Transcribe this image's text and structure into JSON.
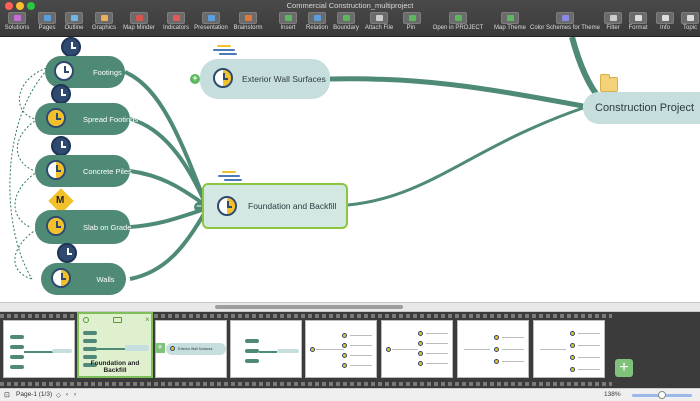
{
  "window": {
    "title": "Commercial Construction_multiproject"
  },
  "toolbar": {
    "items": [
      {
        "label": "Solutions",
        "icon": "solutions-icon",
        "color": "#c96bd8"
      },
      {
        "label": "Pages",
        "icon": "pages-icon",
        "color": "#5b9ee0"
      },
      {
        "label": "Outline",
        "icon": "outline-icon",
        "color": "#6fb6e8"
      },
      {
        "label": "Graphics",
        "icon": "graphics-icon",
        "color": "#e8b05a"
      },
      {
        "label": "Map Minder",
        "icon": "map-minder-icon",
        "color": "#d9534f"
      },
      {
        "label": "Indicators",
        "icon": "indicators-icon",
        "color": "#e05a5a"
      },
      {
        "label": "Presentation",
        "icon": "presentation-icon",
        "color": "#5aa0e0"
      },
      {
        "label": "Brainstorm",
        "icon": "brainstorm-icon",
        "color": "#e07a3a"
      },
      {
        "label": "Insert",
        "icon": "insert-icon",
        "color": "#5cb85c"
      },
      {
        "label": "Relation",
        "icon": "relation-icon",
        "color": "#5b9ee0"
      },
      {
        "label": "Boundary",
        "icon": "boundary-icon",
        "color": "#5cb85c"
      },
      {
        "label": "Attach File",
        "icon": "attach-file-icon",
        "color": "#cccccc"
      },
      {
        "label": "Pin",
        "icon": "pin-icon",
        "color": "#5cb85c"
      },
      {
        "label": "Open in PROJECT",
        "icon": "open-project-icon",
        "color": "#5cb85c"
      },
      {
        "label": "Map Theme",
        "icon": "map-theme-icon",
        "color": "#5cb85c"
      },
      {
        "label": "Color Schemes for Theme",
        "icon": "color-schemes-icon",
        "color": "#8a8ae0"
      },
      {
        "label": "Filter",
        "icon": "filter-icon",
        "color": "#cccccc"
      },
      {
        "label": "Format",
        "icon": "format-icon",
        "color": "#dddddd"
      },
      {
        "label": "Info",
        "icon": "info-icon",
        "color": "#dddddd"
      },
      {
        "label": "Topic",
        "icon": "topic-icon",
        "color": "#dddddd"
      }
    ]
  },
  "map": {
    "central": "Construction Project",
    "main_topics": {
      "exterior": "Exterior Wall Surfaces",
      "foundation": "Foundation and Backfill"
    },
    "subtopics": [
      "Footings",
      "Spread Footings",
      "Concrete Piles",
      "Slab on Grade",
      "Walls"
    ],
    "milestone_label": "M",
    "colors": {
      "subtopic": "#4f8a76",
      "main_topic": "#c7dede",
      "selected_border": "#8cc63f",
      "progress": "#f2c028",
      "clock": "#2f4a6e"
    }
  },
  "slides": {
    "selected_caption": "Foundation and Backfill",
    "preview_label": "Exterior Wall Surfaces"
  },
  "status": {
    "page": "Page-1 (1/3)",
    "zoom": "138%"
  }
}
